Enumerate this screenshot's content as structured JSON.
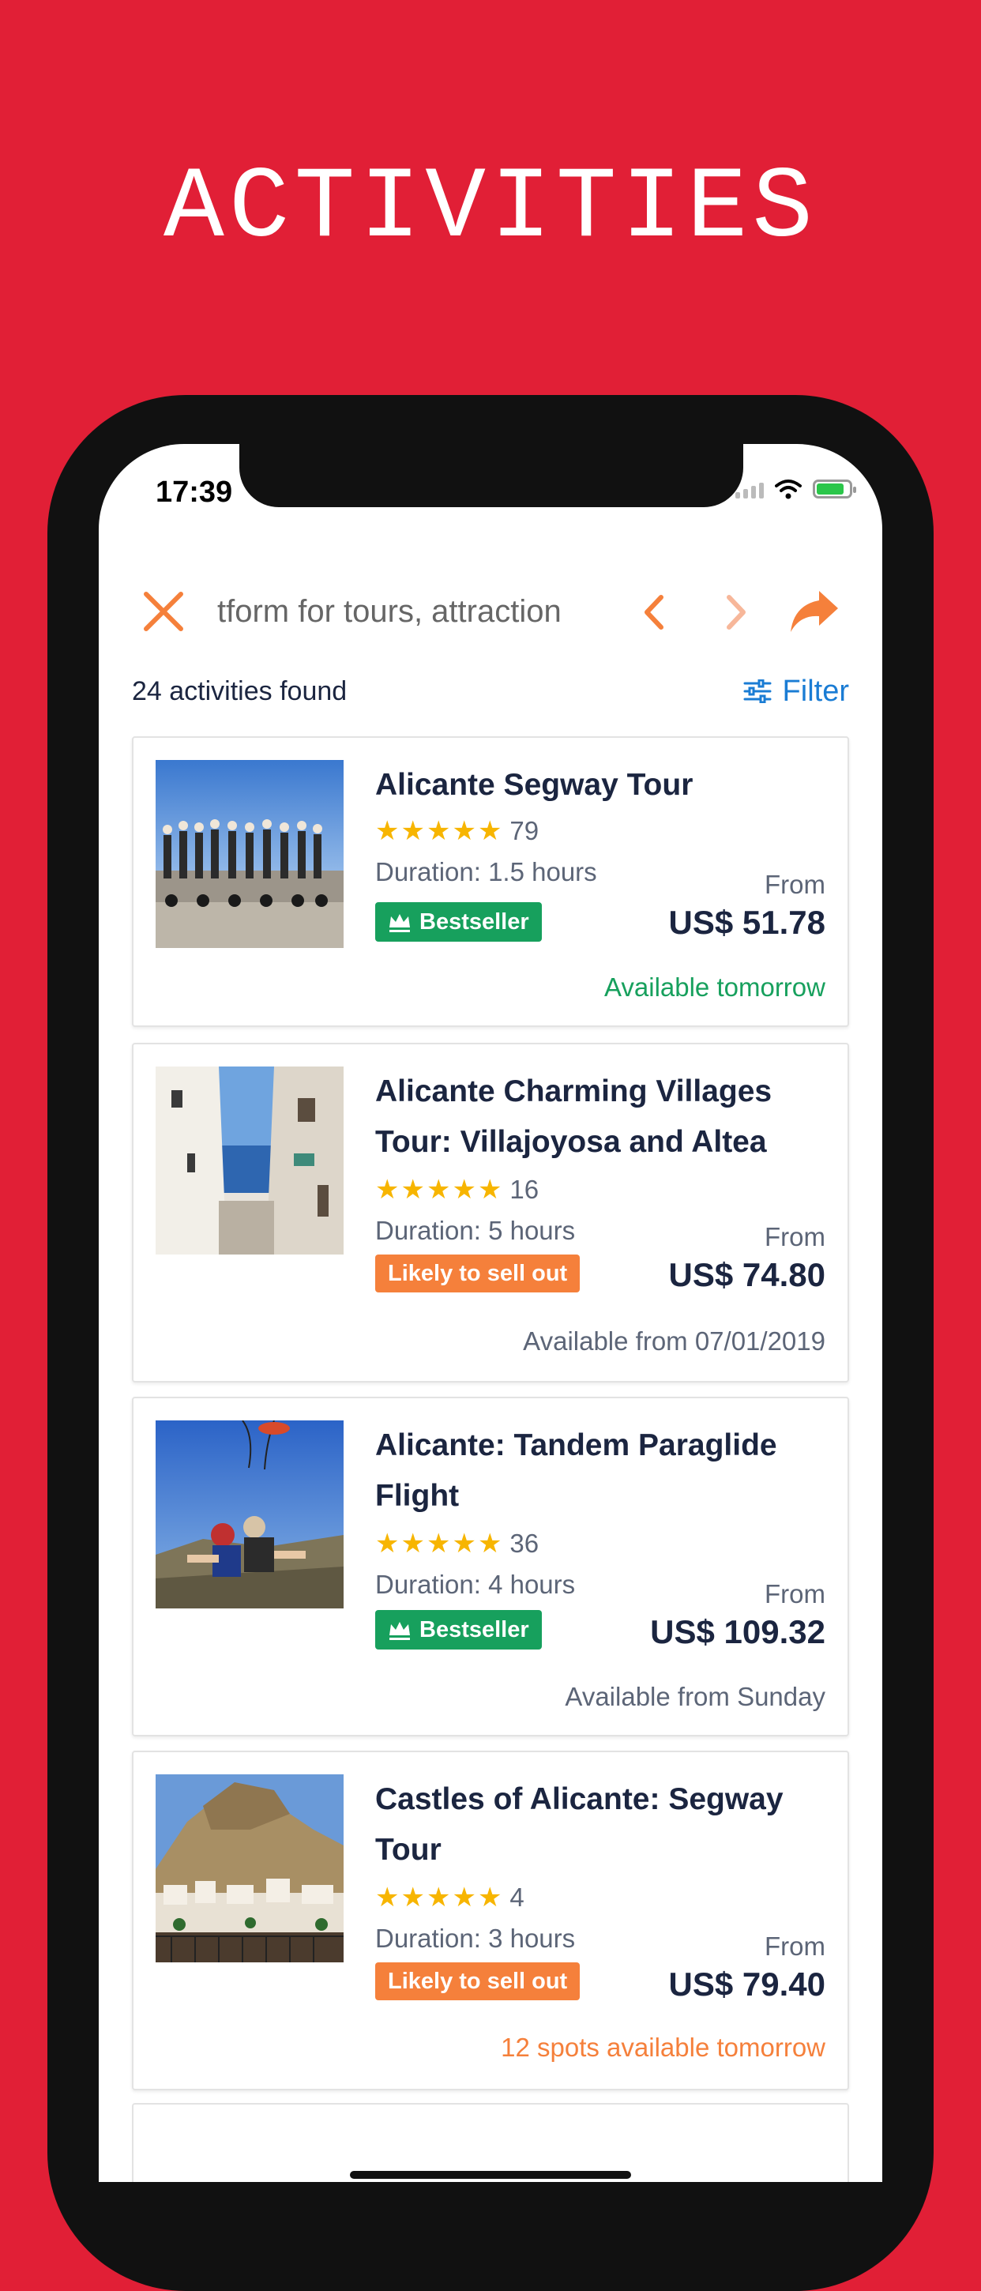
{
  "headline": "ACTIVITIES",
  "status_bar": {
    "time": "17:39"
  },
  "browser_bar": {
    "url_text": "tform for tours, attraction",
    "icons": [
      "close-icon",
      "back-chevron-icon",
      "forward-chevron-icon",
      "share-icon"
    ]
  },
  "results": {
    "count_text": "24 activities found",
    "filter_label": "Filter"
  },
  "activities": [
    {
      "title": "Alicante Segway Tour",
      "stars": 5,
      "reviews": "79",
      "duration": "Duration: 1.5 hours",
      "badge": "Bestseller",
      "from_label": "From",
      "price": "US$ 51.78",
      "availability": "Available tomorrow"
    },
    {
      "title": "Alicante Charming Villages Tour: Villajoyosa and Altea",
      "stars": 5,
      "reviews": "16",
      "duration": "Duration: 5 hours",
      "badge": "Likely to sell out",
      "from_label": "From",
      "price": "US$ 74.80",
      "availability": "Available from 07/01/2019"
    },
    {
      "title": "Alicante: Tandem Paraglide Flight",
      "stars": 5,
      "reviews": "36",
      "duration": "Duration: 4 hours",
      "badge": "Bestseller",
      "from_label": "From",
      "price": "US$ 109.32",
      "availability": "Available from Sunday"
    },
    {
      "title": "Castles of Alicante: Segway Tour",
      "stars": 5,
      "reviews": "4",
      "duration": "Duration: 3 hours",
      "badge": "Likely to sell out",
      "from_label": "From",
      "price": "US$ 79.40",
      "availability": "12 spots available tomorrow"
    }
  ],
  "colors": {
    "background": "#e11f36",
    "accent_orange": "#f5803b",
    "bestseller_green": "#17a05d",
    "filter_blue": "#1a7cd4",
    "star_yellow": "#f7b500",
    "title_navy": "#1b2540"
  }
}
